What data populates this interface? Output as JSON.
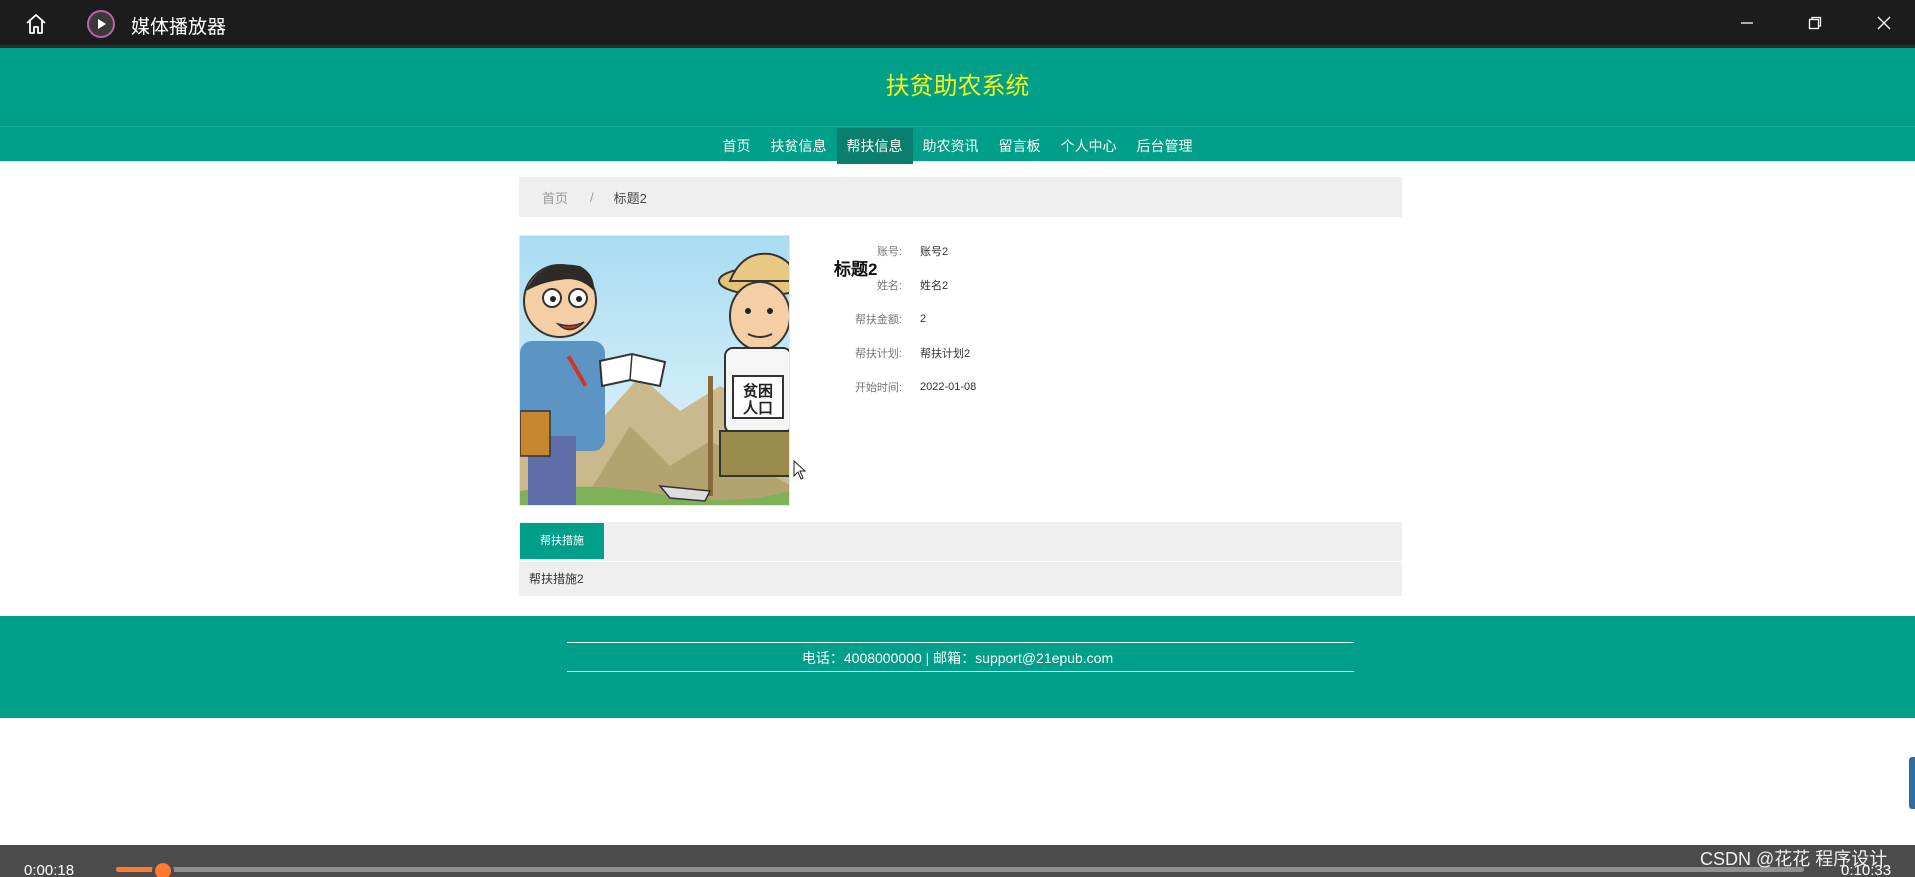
{
  "window": {
    "title": "媒体播放器"
  },
  "site": {
    "title": "扶贫助农系统",
    "nav": [
      {
        "label": "首页"
      },
      {
        "label": "扶贫信息"
      },
      {
        "label": "帮扶信息",
        "active": true
      },
      {
        "label": "助农资讯"
      },
      {
        "label": "留言板"
      },
      {
        "label": "个人中心"
      },
      {
        "label": "后台管理"
      }
    ]
  },
  "breadcrumb": {
    "home": "首页",
    "separator": "/",
    "current": "标题2"
  },
  "detail": {
    "title": "标题2",
    "image_alt": "扶贫漫画",
    "image_text": "贫困人口",
    "fields": [
      {
        "label": "账号:",
        "value": "账号2"
      },
      {
        "label": "姓名:",
        "value": "姓名2"
      },
      {
        "label": "帮扶金额:",
        "value": "2"
      },
      {
        "label": "帮扶计划:",
        "value": "帮扶计划2"
      },
      {
        "label": "开始时间:",
        "value": "2022-01-08"
      }
    ],
    "tab_label": "帮扶措施",
    "tab_content": "帮扶措施2"
  },
  "footer": {
    "contact": "电话：4008000000 | 邮箱：support@21epub.com"
  },
  "player": {
    "elapsed": "0:00:18",
    "total": "0:10:33",
    "progress": 0.028
  },
  "watermark": "CSDN @花花 程序设计",
  "colors": {
    "primary": "#009f89",
    "title_yellow": "#f6f11a",
    "seek": "#ff7a2d"
  }
}
